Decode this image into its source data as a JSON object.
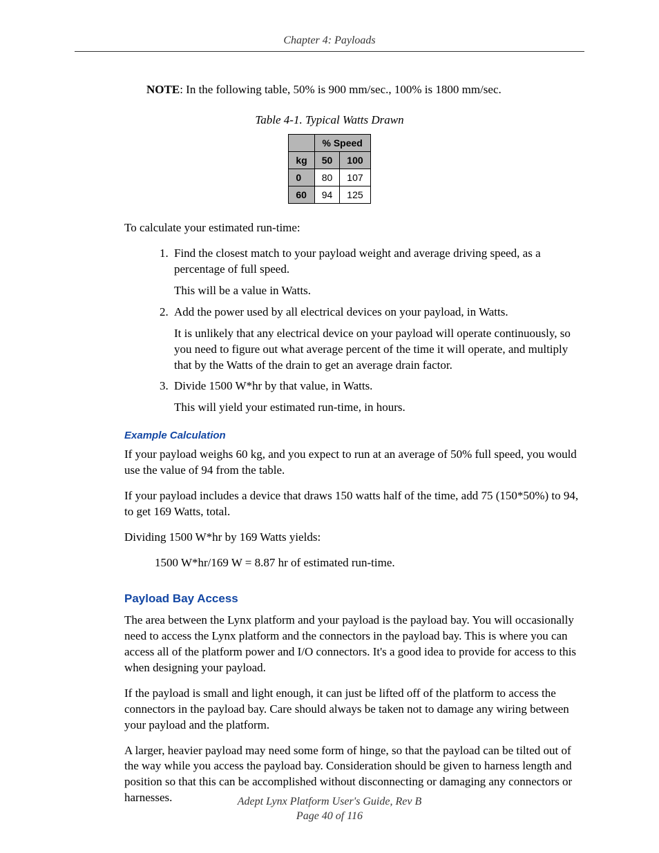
{
  "header": {
    "chapter_line": "Chapter 4: Payloads"
  },
  "note": {
    "label": "NOTE",
    "text": ": In the following table, 50% is 900 mm/sec., 100% is 1800 mm/sec."
  },
  "table": {
    "caption": "Table 4-1. Typical Watts Drawn",
    "header_span": "% Speed",
    "col_kg": "kg",
    "col_50": "50",
    "col_100": "100",
    "rows": [
      {
        "kg": "0",
        "v50": "80",
        "v100": "107"
      },
      {
        "kg": "60",
        "v50": "94",
        "v100": "125"
      }
    ]
  },
  "intro_runtime": "To calculate your estimated run-time:",
  "steps": [
    {
      "main": "Find the closest match to your payload weight and average driving speed, as a percentage of full speed.",
      "sub": "This will be a value in Watts."
    },
    {
      "main": "Add the power used by all electrical devices on your payload, in Watts.",
      "sub": "It is unlikely that any electrical device on your payload will operate continuously, so you need to figure out what average percent of the time it will operate, and multiply that by the Watts of the drain to get an average drain factor."
    },
    {
      "main": "Divide 1500 W*hr by that value, in Watts.",
      "sub": "This will yield your estimated run-time, in hours."
    }
  ],
  "example": {
    "heading": "Example Calculation",
    "p1": "If your payload weighs 60 kg, and you expect to run at an average of 50% full speed, you would use the value of 94 from the table.",
    "p2": "If your payload includes a device that draws 150 watts half of the time, add 75 (150*50%) to 94, to get 169 Watts, total.",
    "p3": "Dividing 1500 W*hr by 169 Watts yields:",
    "p4": "1500 W*hr/169 W = 8.87 hr of estimated run-time."
  },
  "section": {
    "heading": "Payload Bay Access",
    "p1": "The area between the Lynx platform and your payload is the payload bay. You will occasionally need to access the Lynx platform and the connectors in the payload bay. This is where you can access all of the platform power and I/O connectors. It's a good idea to provide for access to this when designing your payload.",
    "p2": "If the payload is small and light enough, it can just be lifted off of the platform to access the connectors in the payload bay. Care should always be taken not to damage any wiring between your payload and the platform.",
    "p3": "A larger, heavier payload may need some form of hinge, so that the payload can be tilted out of the way while you access the payload bay. Consideration should be given to harness length and position so that this can be accomplished without disconnecting or damaging any connectors or harnesses."
  },
  "footer": {
    "line1": "Adept Lynx Platform User's Guide, Rev B",
    "line2": "Page 40 of 116"
  },
  "chart_data": {
    "type": "table",
    "title": "Typical Watts Drawn",
    "column_group": "% Speed",
    "columns": [
      "kg",
      "50",
      "100"
    ],
    "rows": [
      [
        0,
        80,
        107
      ],
      [
        60,
        94,
        125
      ]
    ],
    "note": "50% = 900 mm/sec, 100% = 1800 mm/sec"
  }
}
